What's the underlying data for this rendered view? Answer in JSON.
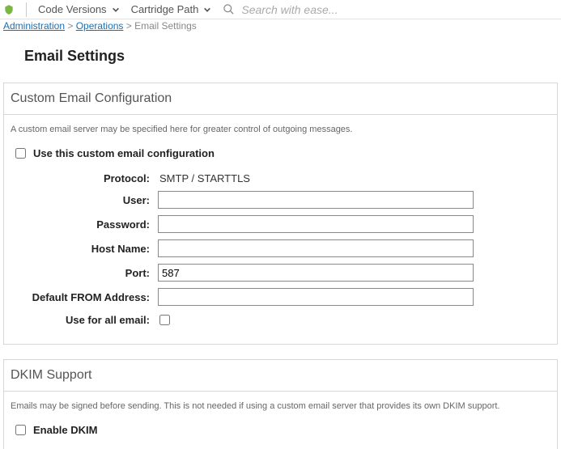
{
  "topbar": {
    "dd1": "Code Versions",
    "dd2": "Cartridge Path",
    "search_placeholder": "Search with ease..."
  },
  "breadcrumb": {
    "items": [
      "Administration",
      "Operations",
      "Email Settings"
    ]
  },
  "page_title": "Email Settings",
  "custom_panel": {
    "header": "Custom Email Configuration",
    "desc": "A custom email server may be specified here for greater control of outgoing messages.",
    "use_label": "Use this custom email configuration",
    "rows": {
      "protocol_label": "Protocol:",
      "protocol_value": "SMTP / STARTTLS",
      "user_label": "User:",
      "user_value": "",
      "password_label": "Password:",
      "password_value": "",
      "host_label": "Host Name:",
      "host_value": "",
      "port_label": "Port:",
      "port_value": "587",
      "from_label": "Default FROM Address:",
      "from_value": "",
      "allmail_label": "Use for all email:"
    }
  },
  "dkim_panel": {
    "header": "DKIM Support",
    "desc": "Emails may be signed before sending. This is not needed if using a custom email server that provides its own DKIM support.",
    "enable_label": "Enable DKIM"
  }
}
